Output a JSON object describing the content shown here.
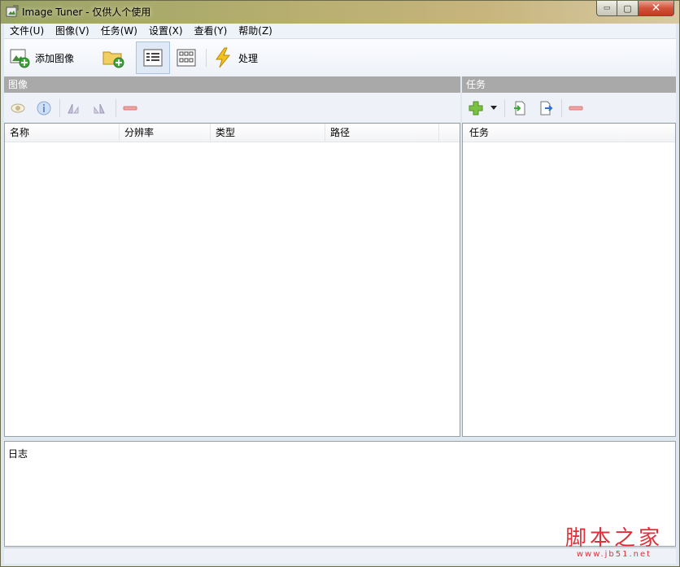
{
  "window": {
    "title": "Image Tuner - 仅供人个使用",
    "min_glyph": "▭",
    "max_glyph": "▢",
    "close_glyph": "✕"
  },
  "menu": [
    "文件(U)",
    "图像(V)",
    "任务(W)",
    "设置(X)",
    "查看(Y)",
    "帮助(Z)"
  ],
  "toolbar": {
    "add_images_label": "添加图像",
    "process_label": "处理",
    "add_folder_icon": "folder-add-icon",
    "details_view_icon": "details-view-icon",
    "thumbnails_view_icon": "thumbnails-view-icon"
  },
  "images_panel": {
    "header": "图像",
    "columns": [
      "名称",
      "分辨率",
      "类型",
      "路径"
    ]
  },
  "tasks_panel": {
    "header": "任务",
    "columns": [
      "任务"
    ]
  },
  "log": {
    "label": "日志"
  },
  "watermark": {
    "main": "脚本之家",
    "url": "www.jb51.net"
  },
  "colors": {
    "panel_header": "#a9a9a9",
    "accent_red": "#e0303a"
  }
}
